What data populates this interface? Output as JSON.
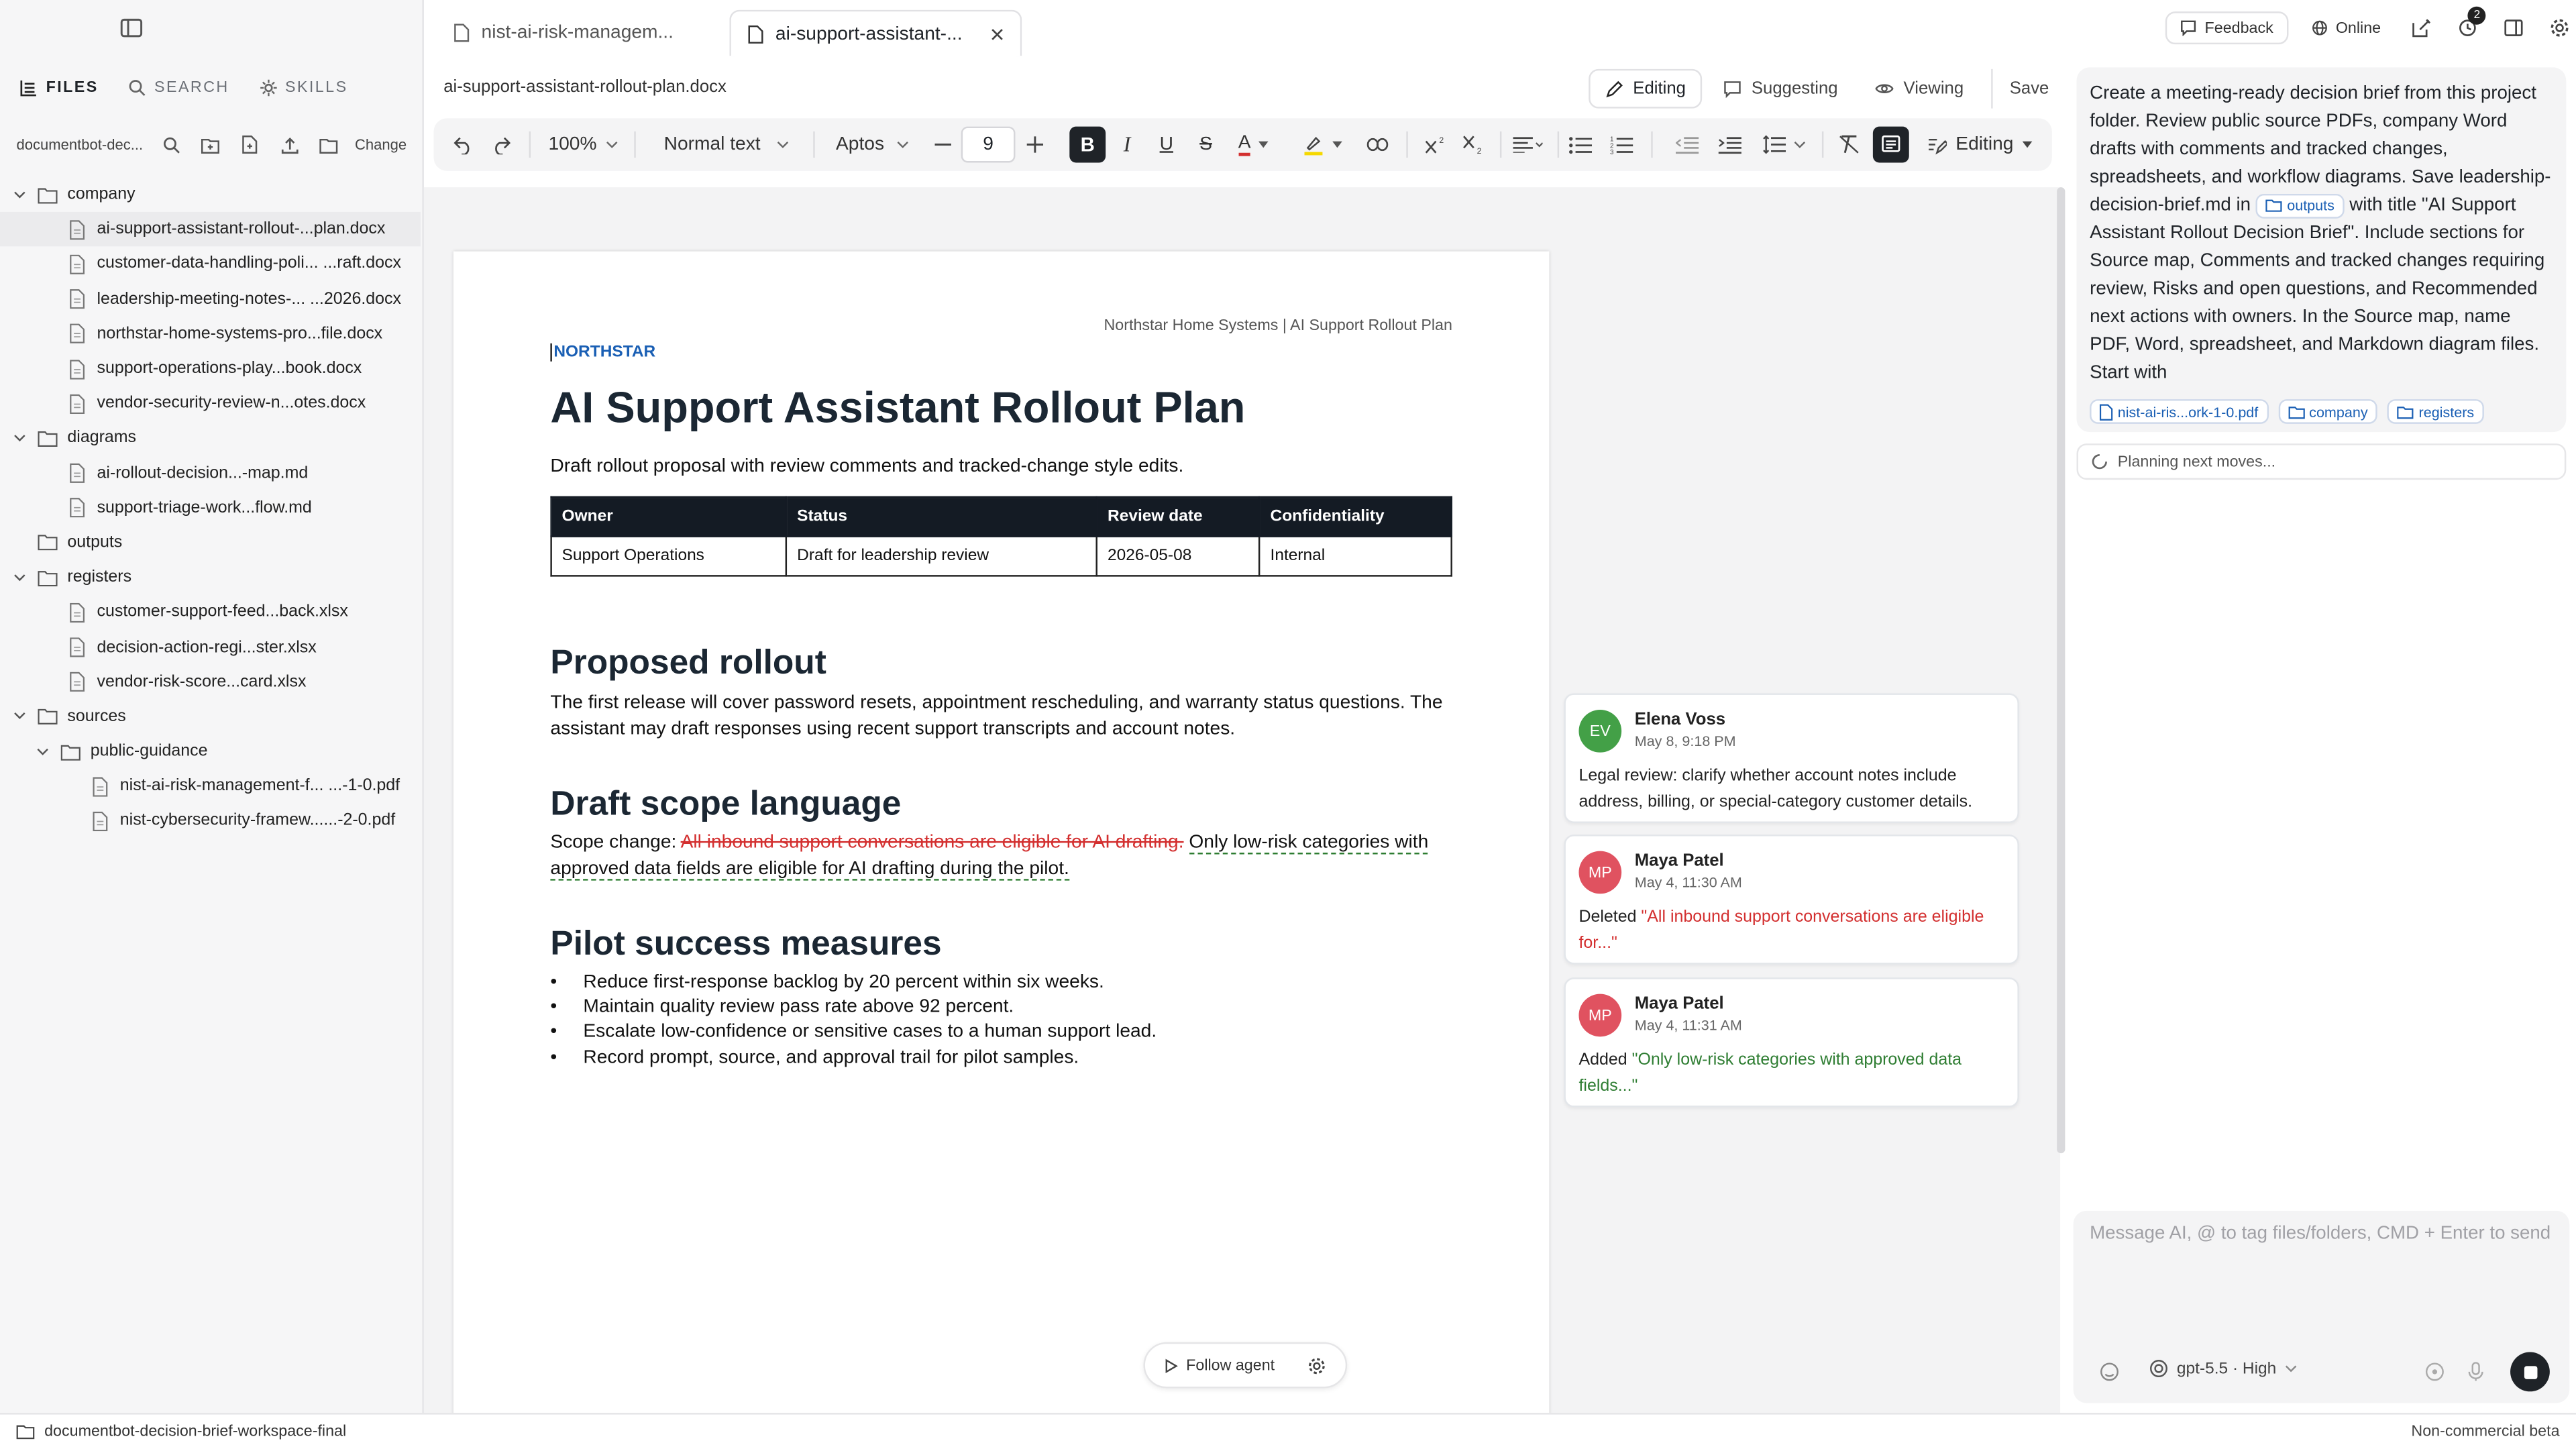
{
  "sidebar": {
    "tabs": [
      {
        "label": "FILES",
        "icon": "files-icon"
      },
      {
        "label": "SEARCH",
        "icon": "search-icon"
      },
      {
        "label": "SKILLS",
        "icon": "skills-icon"
      }
    ],
    "path": "documentbot-dec...",
    "change_label": "Change",
    "tree": [
      {
        "label": "company",
        "type": "folder",
        "depth": 0,
        "expanded": true
      },
      {
        "label": "ai-support-assistant-rollout-...plan.docx",
        "type": "file",
        "depth": 1,
        "selected": true
      },
      {
        "label": "customer-data-handling-poli... ...raft.docx",
        "type": "file",
        "depth": 1
      },
      {
        "label": "leadership-meeting-notes-... ...2026.docx",
        "type": "file",
        "depth": 1
      },
      {
        "label": "northstar-home-systems-pro...file.docx",
        "type": "file",
        "depth": 1
      },
      {
        "label": "support-operations-play...book.docx",
        "type": "file",
        "depth": 1
      },
      {
        "label": "vendor-security-review-n...otes.docx",
        "type": "file",
        "depth": 1
      },
      {
        "label": "diagrams",
        "type": "folder",
        "depth": 0,
        "expanded": true
      },
      {
        "label": "ai-rollout-decision...-map.md",
        "type": "file",
        "depth": 1
      },
      {
        "label": "support-triage-work...flow.md",
        "type": "file",
        "depth": 1
      },
      {
        "label": "outputs",
        "type": "folder",
        "depth": 0,
        "expanded": false
      },
      {
        "label": "registers",
        "type": "folder",
        "depth": 0,
        "expanded": true
      },
      {
        "label": "customer-support-feed...back.xlsx",
        "type": "file",
        "depth": 1
      },
      {
        "label": "decision-action-regi...ster.xlsx",
        "type": "file",
        "depth": 1
      },
      {
        "label": "vendor-risk-score...card.xlsx",
        "type": "file",
        "depth": 1
      },
      {
        "label": "sources",
        "type": "folder",
        "depth": 0,
        "expanded": true
      },
      {
        "label": "public-guidance",
        "type": "folder",
        "depth": 1,
        "expanded": true
      },
      {
        "label": "nist-ai-risk-management-f... ...-1-0.pdf",
        "type": "file",
        "depth": 2
      },
      {
        "label": "nist-cybersecurity-framew......-2-0.pdf",
        "type": "file",
        "depth": 2
      }
    ]
  },
  "status": {
    "workspace": "documentbot-decision-brief-workspace-final",
    "right": "Non-commercial beta"
  },
  "tabs": [
    {
      "label": "nist-ai-risk-managem..."
    },
    {
      "label": "ai-support-assistant-..."
    }
  ],
  "topright": {
    "feedback": "Feedback",
    "online": "Online",
    "badge_count": "2"
  },
  "doc_header": {
    "filename": "ai-support-assistant-rollout-plan.docx",
    "modes": [
      "Editing",
      "Suggesting",
      "Viewing"
    ],
    "save": "Save"
  },
  "toolbar": {
    "zoom": "100%",
    "style": "Normal text",
    "font": "Aptos",
    "font_size": "9",
    "bold": "B",
    "italic": "I",
    "underline": "U",
    "strike": "S",
    "color_letter": "A",
    "mode": "Editing"
  },
  "doc": {
    "header_right": "Northstar Home Systems | AI Support Rollout Plan",
    "brand": "NORTHSTAR",
    "title": "AI Support Assistant Rollout Plan",
    "subtitle": "Draft rollout proposal with review comments and tracked-change style edits.",
    "table": {
      "headers": [
        "Owner",
        "Status",
        "Review date",
        "Confidentiality"
      ],
      "row": [
        "Support Operations",
        "Draft for leadership review",
        "2026-05-08",
        "Internal"
      ]
    },
    "h_rollout": "Proposed rollout",
    "p_rollout": "The first release will cover password resets, appointment rescheduling, and warranty status questions. The assistant may draft responses using recent support transcripts and account notes.",
    "h_scope": "Draft scope language",
    "scope_prefix": "Scope change: ",
    "scope_deleted": "All inbound support conversations are eligible for AI drafting.",
    "scope_inserted": "Only low-risk categories with approved data fields are eligible for AI drafting during the pilot.",
    "h_measures": "Pilot success measures",
    "bullets": [
      "Reduce first-response backlog by 20 percent within six weeks.",
      "Maintain quality review pass rate above 92 percent.",
      "Escalate low-confidence or sensitive cases to a human support lead.",
      "Record prompt, source, and approval trail for pilot samples."
    ],
    "bullet_char": "•"
  },
  "comments": [
    {
      "initials": "EV",
      "name": "Elena Voss",
      "date": "May 8, 9:18 PM",
      "color": "#43a047",
      "body": "Legal review: clarify whether account notes include address, billing, or special-category customer details."
    },
    {
      "initials": "MP",
      "name": "Maya Patel",
      "date": "May 4, 11:30 AM",
      "color": "#e05260",
      "prefix": "Deleted ",
      "quote": "\"All inbound support conversations are eligible for...\""
    },
    {
      "initials": "MP",
      "name": "Maya Patel",
      "date": "May 4, 11:31 AM",
      "color": "#e05260",
      "prefix": "Added ",
      "quote": "\"Only low-risk categories with approved data fields...\""
    }
  ],
  "follow_agent": "Follow agent",
  "ai": {
    "prompt_1": "Create a meeting-ready decision brief from this project folder. Review public source PDFs, company Word drafts with comments and tracked changes, spreadsheets, and workflow diagrams. Save leadership-decision-brief.md in ",
    "prompt_chip": "outputs",
    "prompt_2": " with title \"AI Support Assistant Rollout Decision Brief\". Include sections for Source map, Comments and tracked changes requiring review, Risks and open questions, and Recommended next actions with owners. In the Source map, name PDF, Word, spreadsheet, and Markdown diagram files. Start with",
    "chips": [
      "nist-ai-ris...ork-1-0.pdf",
      "company",
      "registers"
    ],
    "planning": "Planning next moves...",
    "placeholder": "Message AI, @ to tag files/folders, CMD + Enter to send",
    "model": "gpt-5.5 · High"
  },
  "colors": {
    "accent": "#1a5fb4",
    "deleted": "#d32f2f",
    "inserted": "#2e7d32",
    "table_header": "#141b24"
  }
}
